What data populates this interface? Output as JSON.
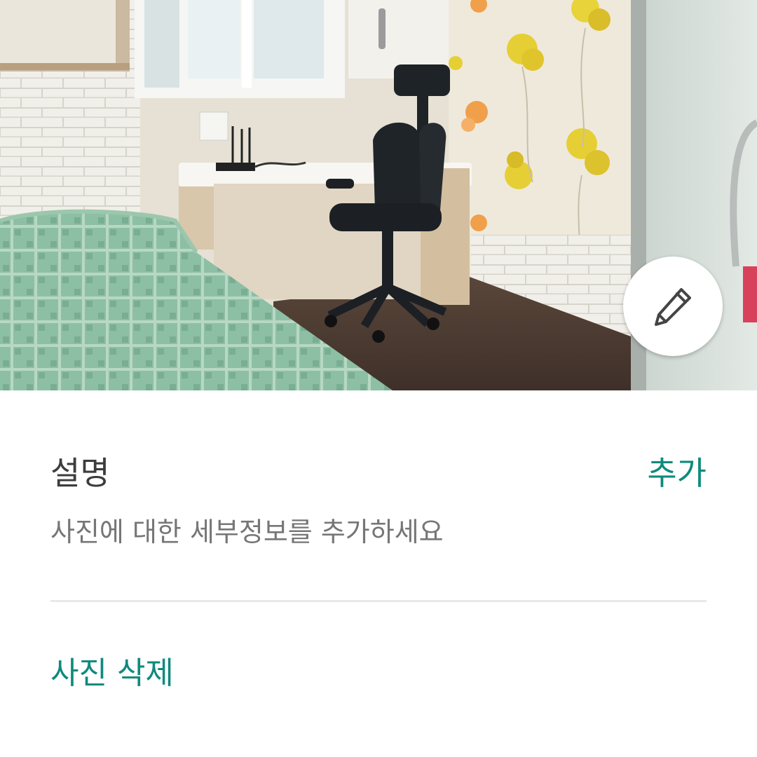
{
  "photo": {
    "edit_icon": "pencil-icon"
  },
  "description": {
    "title": "설명",
    "add_label": "추가",
    "placeholder": "사진에 대한 세부정보를 추가하세요"
  },
  "actions": {
    "delete_label": "사진 삭제"
  },
  "colors": {
    "accent": "#0f8a7e",
    "title_text": "#3c3c3c",
    "secondary_text": "#767676",
    "divider": "#e8e8e8"
  }
}
